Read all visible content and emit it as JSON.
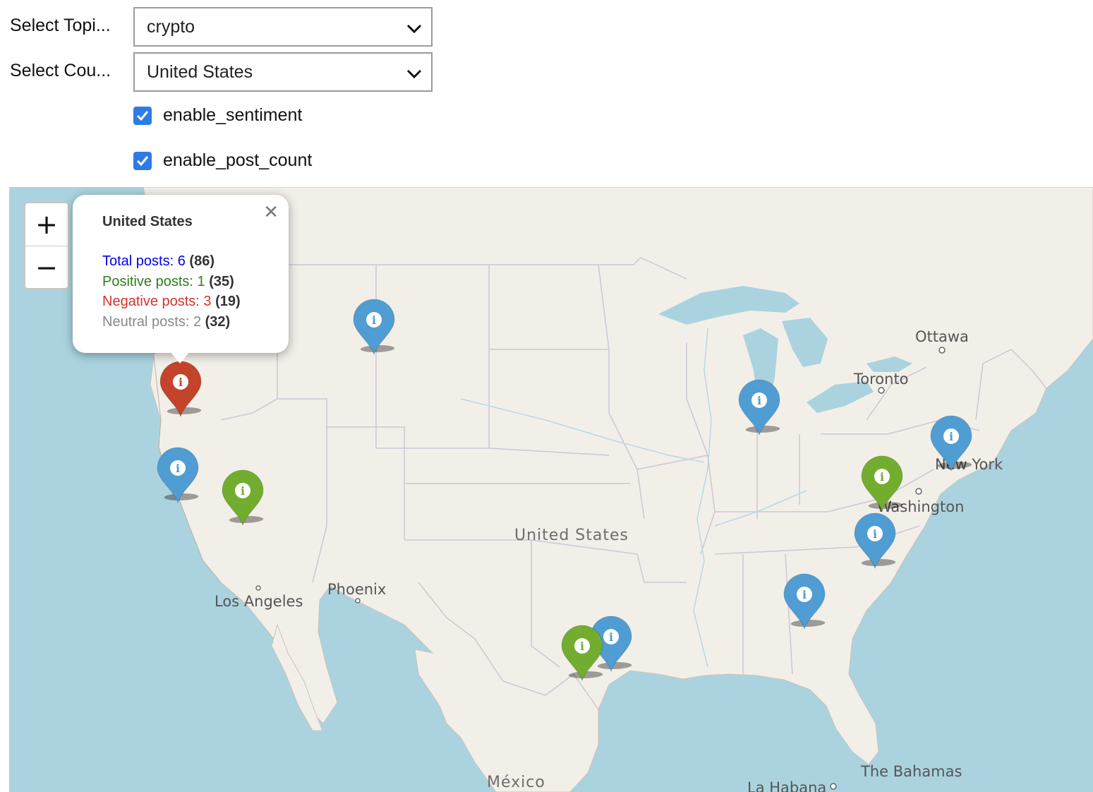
{
  "controls": {
    "topic_label": "Select Topi...",
    "topic_value": "crypto",
    "country_label": "Select Cou...",
    "country_value": "United States",
    "checkbox_sentiment": "enable_sentiment",
    "checkbox_post_count": "enable_post_count",
    "sentiment_checked": true,
    "post_count_checked": true
  },
  "map": {
    "zoom_in": "+",
    "zoom_out": "−",
    "labels": {
      "ottawa": "Ottawa",
      "toronto": "Toronto",
      "new_york": "New York",
      "washington": "Washington",
      "united_states": "United States",
      "phoenix": "Phoenix",
      "los_angeles": "Los Angeles",
      "the_bahamas": "The Bahamas",
      "mexico": "México",
      "la_habana": "La Habana"
    },
    "popup": {
      "title": "United States",
      "close": "✕",
      "total_label": "Total posts: 6",
      "total_count": "(86)",
      "positive_label": "Positive posts: 1",
      "positive_count": "(35)",
      "negative_label": "Negative posts: 3",
      "negative_count": "(19)",
      "neutral_label": "Neutral posts: 2",
      "neutral_count": "(32)"
    },
    "marker_colors": {
      "blue": "#4f9dd2",
      "green": "#72ad2f",
      "red": "#c4432b"
    },
    "markers": [
      {
        "name": "marker-oregon",
        "color": "red"
      },
      {
        "name": "marker-montana",
        "color": "blue"
      },
      {
        "name": "marker-san-francisco",
        "color": "blue"
      },
      {
        "name": "marker-nevada",
        "color": "green"
      },
      {
        "name": "marker-chicago",
        "color": "blue"
      },
      {
        "name": "marker-new-york",
        "color": "blue"
      },
      {
        "name": "marker-virginia",
        "color": "green"
      },
      {
        "name": "marker-north-carolina",
        "color": "blue"
      },
      {
        "name": "marker-atlanta",
        "color": "blue"
      },
      {
        "name": "marker-houston",
        "color": "blue"
      },
      {
        "name": "marker-texas",
        "color": "green"
      }
    ],
    "marker_icon": "info-icon"
  }
}
